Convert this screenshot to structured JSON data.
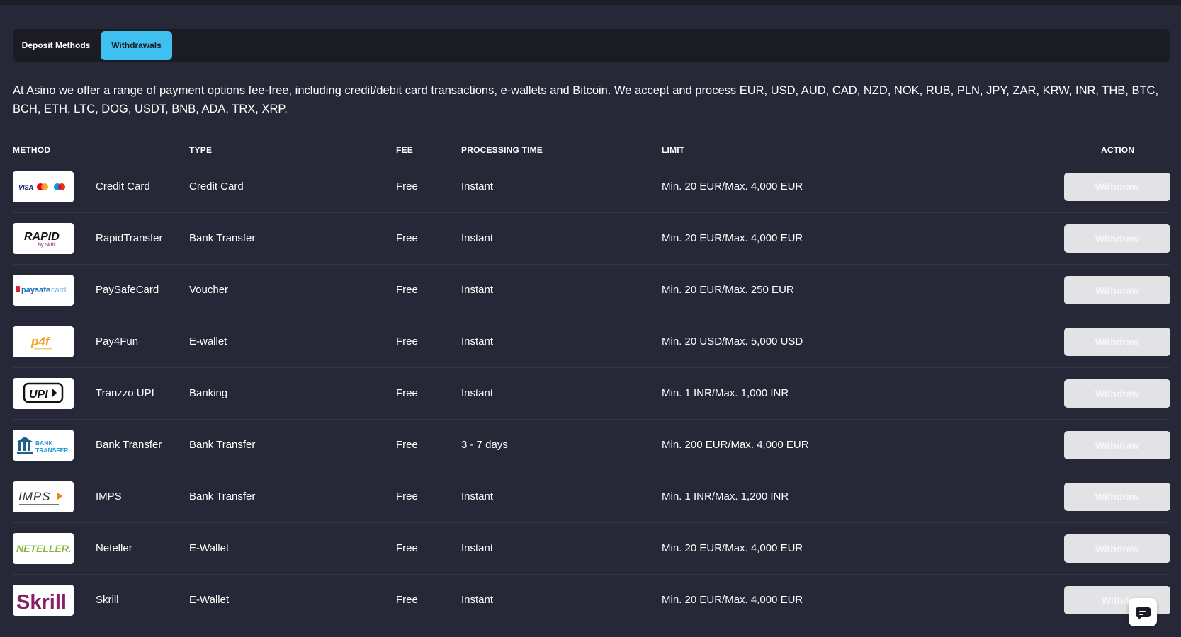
{
  "tabs": [
    {
      "label": "Deposit Methods",
      "active": false
    },
    {
      "label": "Withdrawals",
      "active": true
    }
  ],
  "intro": "At Asino we offer a range of payment options fee-free, including credit/debit card transactions, e-wallets and Bitcoin. We accept and process EUR, USD, AUD, CAD, NZD, NOK, RUB, PLN, JPY, ZAR, KRW, INR, THB, BTC, BCH, ETH, LTC, DOG, USDT, BNB, ADA, TRX, XRP.",
  "headers": {
    "method": "METHOD",
    "type": "TYPE",
    "fee": "FEE",
    "processing_time": "PROCESSING TIME",
    "limit": "LIMIT",
    "action": "ACTION"
  },
  "rows": [
    {
      "logo_icon": "credit-card-logo-icon",
      "name": "Credit Card",
      "type": "Credit Card",
      "fee": "Free",
      "time": "Instant",
      "limit": "Min. 20 EUR/Max. 4,000 EUR",
      "action": "Withdraw"
    },
    {
      "logo_icon": "rapidtransfer-logo-icon",
      "logo_text": "RAPID",
      "logo_sub": "by Skrill",
      "name": "RapidTransfer",
      "type": "Bank Transfer",
      "fee": "Free",
      "time": "Instant",
      "limit": "Min. 20 EUR/Max. 4,000 EUR",
      "action": "Withdraw"
    },
    {
      "logo_icon": "paysafecard-logo-icon",
      "logo_text": "paysafecard",
      "name": "PaySafeCard",
      "type": "Voucher",
      "fee": "Free",
      "time": "Instant",
      "limit": "Min. 20 EUR/Max. 250 EUR",
      "action": "Withdraw"
    },
    {
      "logo_icon": "pay4fun-logo-icon",
      "logo_text": "p4f",
      "name": "Pay4Fun",
      "type": "E-wallet",
      "fee": "Free",
      "time": "Instant",
      "limit": "Min. 20 USD/Max. 5,000 USD",
      "action": "Withdraw"
    },
    {
      "logo_icon": "upi-logo-icon",
      "logo_text": "UPI",
      "name": "Tranzzo UPI",
      "type": "Banking",
      "fee": "Free",
      "time": "Instant",
      "limit": "Min. 1 INR/Max. 1,000 INR",
      "action": "Withdraw"
    },
    {
      "logo_icon": "bank-transfer-logo-icon",
      "logo_text": "BANK TRANSFER",
      "name": "Bank Transfer",
      "type": "Bank Transfer",
      "fee": "Free",
      "time": "3 - 7 days",
      "limit": "Min. 200 EUR/Max. 4,000 EUR",
      "action": "Withdraw"
    },
    {
      "logo_icon": "imps-logo-icon",
      "logo_text": "IMPS",
      "name": "IMPS",
      "type": "Bank Transfer",
      "fee": "Free",
      "time": "Instant",
      "limit": "Min. 1 INR/Max. 1,200 INR",
      "action": "Withdraw"
    },
    {
      "logo_icon": "neteller-logo-icon",
      "logo_text": "NETELLER",
      "name": "Neteller",
      "type": "E-Wallet",
      "fee": "Free",
      "time": "Instant",
      "limit": "Min. 20 EUR/Max. 4,000 EUR",
      "action": "Withdraw"
    },
    {
      "logo_icon": "skrill-logo-icon",
      "logo_text": "Skrill",
      "name": "Skrill",
      "type": "E-Wallet",
      "fee": "Free",
      "time": "Instant",
      "limit": "Min. 20 EUR/Max. 4,000 EUR",
      "action": "Withdr"
    }
  ],
  "chat_icon": "chat-bubble-icon",
  "colors": {
    "background": "#262837",
    "tab_active": "#3fc0f0",
    "button": "#e3e3e6"
  }
}
